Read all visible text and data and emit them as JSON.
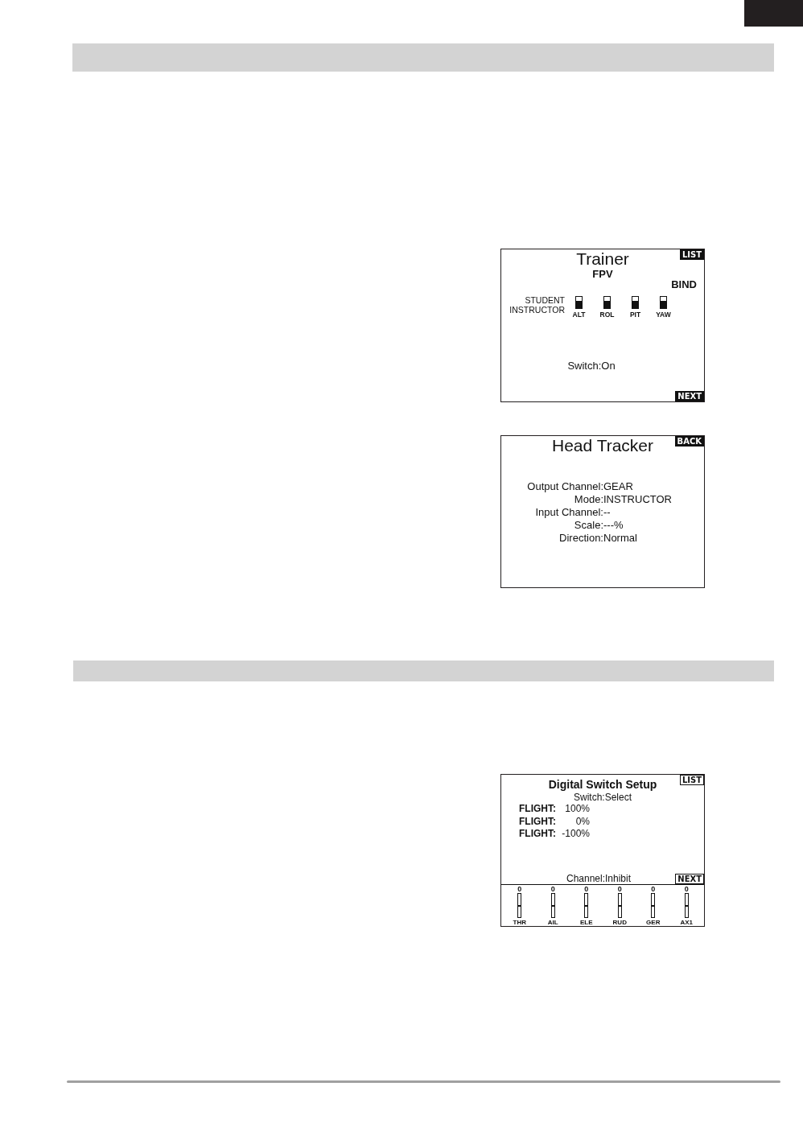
{
  "screens": [
    {
      "kind": "trainer",
      "title": "Trainer",
      "subtitle": "FPV",
      "top_button": {
        "label": "LIST",
        "kind": "filled"
      },
      "bottom_button": {
        "label": "NEXT",
        "kind": "filled"
      },
      "option": "BIND",
      "row_labels": [
        "STUDENT",
        "INSTRUCTOR"
      ],
      "channels": [
        {
          "label": "ALT",
          "instructor": true
        },
        {
          "label": "ROL",
          "instructor": true
        },
        {
          "label": "PIT",
          "instructor": true
        },
        {
          "label": "YAW",
          "instructor": true
        }
      ],
      "status": "Switch:On"
    },
    {
      "kind": "form",
      "title": "Head Tracker",
      "top_button": {
        "label": "BACK",
        "kind": "filled"
      },
      "fields": [
        {
          "label": "Output Channel:",
          "value": "GEAR"
        },
        {
          "label": "Mode:",
          "value": "INSTRUCTOR"
        },
        {
          "label": "Input Channel:",
          "value": "--"
        },
        {
          "label": "Scale:",
          "value": "---%"
        },
        {
          "label": "Direction:",
          "value": "Normal"
        }
      ]
    },
    {
      "kind": "switch_setup",
      "title": "Digital Switch Setup",
      "top_button": {
        "label": "LIST",
        "kind": "outlined"
      },
      "bottom_button": {
        "label": "NEXT",
        "kind": "outlined"
      },
      "switch": "Switch:Select",
      "rows": [
        {
          "label": "FLIGHT:",
          "value": "100%"
        },
        {
          "label": "FLIGHT:",
          "value": "0%"
        },
        {
          "label": "FLIGHT:",
          "value": "-100%"
        }
      ],
      "channel": "Channel:Inhibit",
      "monitors": [
        {
          "value": "0",
          "label": "THR",
          "level": 0.5
        },
        {
          "value": "0",
          "label": "AIL",
          "level": 0.5
        },
        {
          "value": "0",
          "label": "ELE",
          "level": 0.5
        },
        {
          "value": "0",
          "label": "RUD",
          "level": 0.5
        },
        {
          "value": "0",
          "label": "GER",
          "level": 0.5
        },
        {
          "value": "0",
          "label": "AX1",
          "level": 0.5
        }
      ]
    }
  ]
}
